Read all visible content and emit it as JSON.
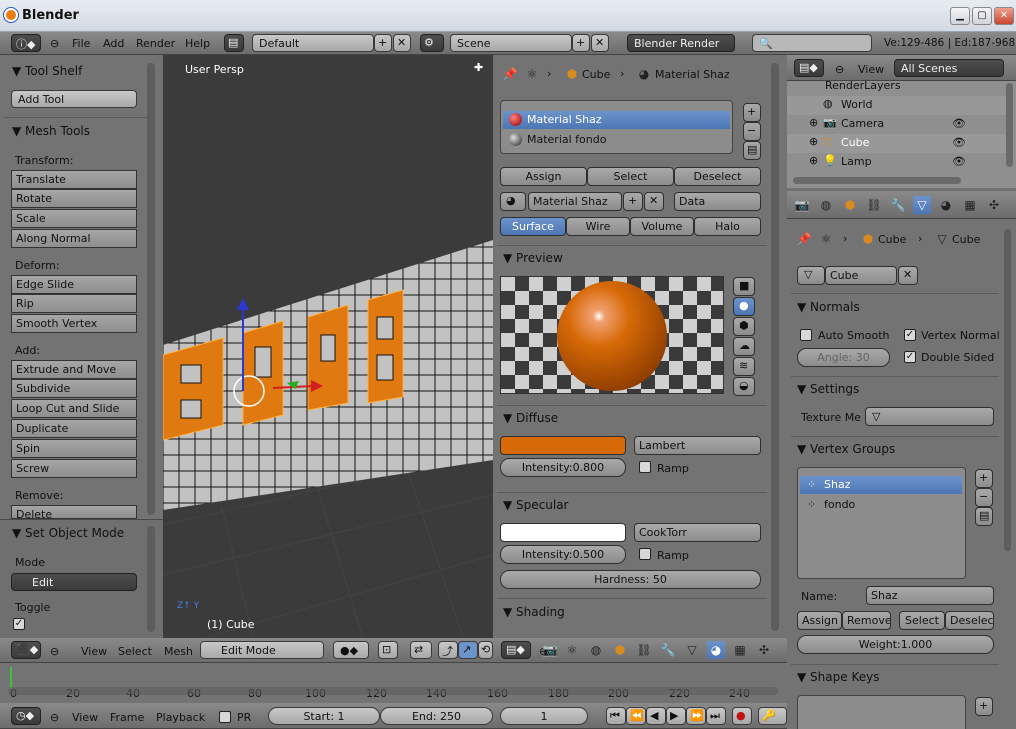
{
  "window": {
    "title": "Blender",
    "min": "▁",
    "max": "▢",
    "close": "✕"
  },
  "info": {
    "menus": [
      "File",
      "Add",
      "Render",
      "Help"
    ],
    "screen": "Default",
    "scene": "Scene",
    "engine": "Blender Render",
    "stats": "Ve:129-486 | Ed:187-968"
  },
  "toolshelf": {
    "title": "Tool Shelf",
    "add_tool": "Add Tool",
    "mesh_tools": "Mesh Tools",
    "transform_label": "Transform:",
    "transform": [
      "Translate",
      "Rotate",
      "Scale",
      "Along Normal"
    ],
    "deform_label": "Deform:",
    "deform": [
      "Edge Slide",
      "Rip",
      "Smooth Vertex"
    ],
    "add_label": "Add:",
    "add": [
      "Extrude and Move",
      "Subdivide",
      "Loop Cut and Slide",
      "Duplicate",
      "Spin",
      "Screw"
    ],
    "remove_label": "Remove:",
    "remove": [
      "Delete"
    ],
    "set_mode_title": "Set Object Mode",
    "mode_label": "Mode",
    "mode_value": "Edit",
    "toggle_label": "Toggle"
  },
  "viewport": {
    "persp": "User Persp",
    "object": "(1) Cube"
  },
  "view3d_header": {
    "menus": [
      "View",
      "Select",
      "Mesh"
    ],
    "mode": "Edit Mode"
  },
  "material": {
    "breadcrumb_obj": "Cube",
    "breadcrumb_mat": "Material Shaz",
    "slots": [
      "Material Shaz",
      "Material fondo"
    ],
    "assign": "Assign",
    "select": "Select",
    "deselect": "Deselect",
    "name": "Material Shaz",
    "link": "Data",
    "tabs": [
      "Surface",
      "Wire",
      "Volume",
      "Halo"
    ],
    "preview": "Preview",
    "diffuse": "Diffuse",
    "diffuse_shader": "Lambert",
    "diffuse_intensity": "Intensity:0.800",
    "ramp": "Ramp",
    "specular": "Specular",
    "specular_shader": "CookTorr",
    "specular_intensity": "Intensity:0.500",
    "hardness": "Hardness: 50",
    "shading": "Shading",
    "diffuse_color": "#d76a07",
    "specular_color": "#ffffff"
  },
  "outliner": {
    "view": "View",
    "scenes": "All Scenes",
    "items": [
      "RenderLayers",
      "World",
      "Camera",
      "Cube",
      "Lamp"
    ]
  },
  "props": {
    "obj": "Cube",
    "mesh": "Cube",
    "mesh_name": "Cube",
    "normals": "Normals",
    "auto_smooth": "Auto Smooth",
    "vertex_normal": "Vertex Normal",
    "angle": "Angle: 30",
    "double_sided": "Double Sided",
    "settings": "Settings",
    "texture_mesh": "Texture Me",
    "vertex_groups": "Vertex Groups",
    "groups": [
      "Shaz",
      "fondo"
    ],
    "name_label": "Name:",
    "name_value": "Shaz",
    "assign": "Assign",
    "remove": "Remove",
    "select": "Select",
    "deselect": "Deselect",
    "weight": "Weight:1.000",
    "shape_keys": "Shape Keys"
  },
  "timeline": {
    "ticks": [
      "0",
      "20",
      "40",
      "60",
      "80",
      "100",
      "120",
      "140",
      "160",
      "180",
      "200",
      "220",
      "240"
    ],
    "menus": [
      "View",
      "Frame",
      "Playback"
    ],
    "pr": "PR",
    "start": "Start: 1",
    "end": "End: 250",
    "current": "1"
  }
}
